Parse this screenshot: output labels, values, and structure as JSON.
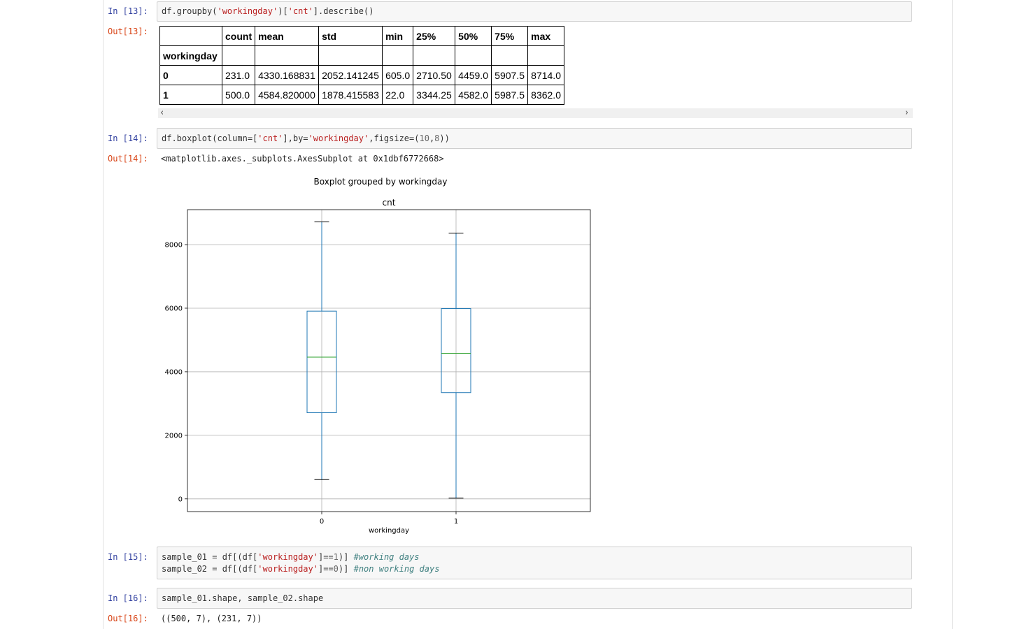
{
  "cells": {
    "c13": {
      "in_prompt": "In [13]:",
      "out_prompt": "Out[13]:",
      "code": {
        "p1": "df.groupby(",
        "s1": "'workingday'",
        "p2": ")[",
        "s2": "'cnt'",
        "p3": "].describe()"
      },
      "table": {
        "columns": [
          "count",
          "mean",
          "std",
          "min",
          "25%",
          "50%",
          "75%",
          "max"
        ],
        "index_name": "workingday",
        "rows": [
          {
            "index": "0",
            "values": [
              "231.0",
              "4330.168831",
              "2052.141245",
              "605.0",
              "2710.50",
              "4459.0",
              "5907.5",
              "8714.0"
            ]
          },
          {
            "index": "1",
            "values": [
              "500.0",
              "4584.820000",
              "1878.415583",
              "22.0",
              "3344.25",
              "4582.0",
              "5987.5",
              "8362.0"
            ]
          }
        ]
      },
      "scroll_left": "‹",
      "scroll_right": "›"
    },
    "c14": {
      "in_prompt": "In [14]:",
      "out_prompt": "Out[14]:",
      "code": {
        "p1": "df.boxplot(column=[",
        "s1": "'cnt'",
        "p2": "],by=",
        "s2": "'workingday'",
        "p3": ",figsize=(",
        "n1": "10",
        "p4": ",",
        "n2": "8",
        "p5": "))"
      },
      "output": "<matplotlib.axes._subplots.AxesSubplot at 0x1dbf6772668>"
    },
    "c15": {
      "in_prompt": "In [15]:",
      "line1": {
        "p1": "sample_01 = df[(df[",
        "s1": "'workingday'",
        "p2": "]==",
        "n1": "1",
        "p3": ")] ",
        "c1": "#working days"
      },
      "line2": {
        "p1": "sample_02 = df[(df[",
        "s1": "'workingday'",
        "p2": "]==",
        "n1": "0",
        "p3": ")] ",
        "c1": "#non working days"
      }
    },
    "c16": {
      "in_prompt": "In [16]:",
      "out_prompt": "Out[16]:",
      "code": "sample_01.shape, sample_02.shape",
      "output": "((500, 7), (231, 7))"
    }
  },
  "chart_data": {
    "type": "box",
    "suptitle": "Boxplot grouped by workingday",
    "title": "cnt",
    "xlabel": "workingday",
    "ylabel": "",
    "categories": [
      "0",
      "1"
    ],
    "yticks": [
      0,
      2000,
      4000,
      6000,
      8000
    ],
    "ylim": [
      -400,
      9100
    ],
    "grid": true,
    "boxes": [
      {
        "category": "0",
        "whisker_low": 605,
        "q1": 2710.5,
        "median": 4459,
        "q3": 5907.5,
        "whisker_high": 8714
      },
      {
        "category": "1",
        "whisker_low": 22,
        "q1": 3344.25,
        "median": 4582,
        "q3": 5987.5,
        "whisker_high": 8362
      }
    ],
    "colors": {
      "box": "#1f77b4",
      "median": "#2ca02c",
      "whisker_cap": "#000000",
      "grid": "#b0b0b0"
    }
  }
}
